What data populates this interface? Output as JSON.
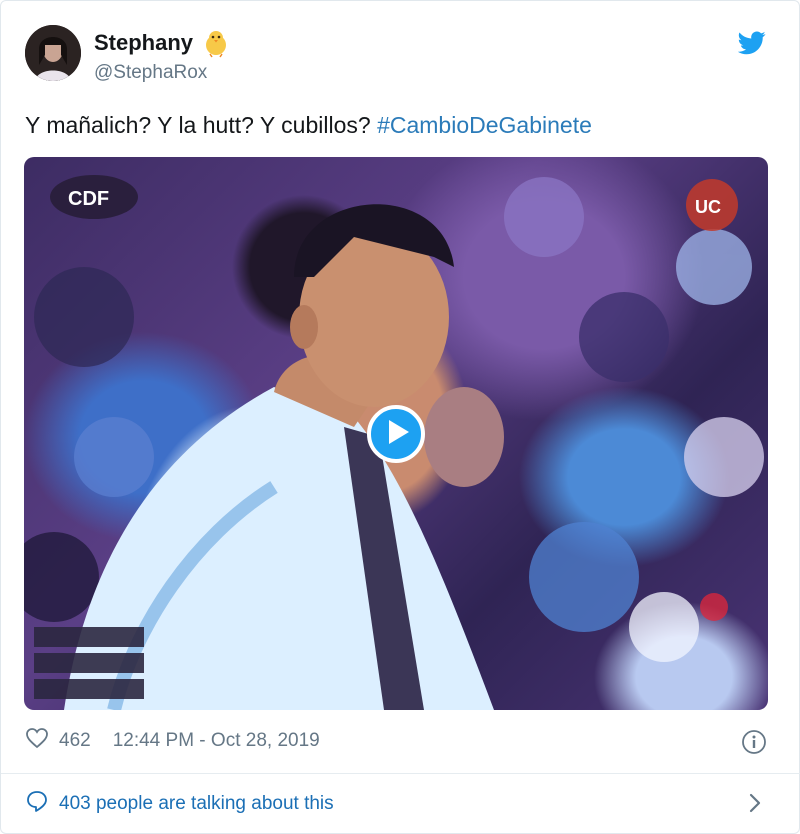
{
  "author": {
    "display_name": "Stephany",
    "handle": "@StephaRox",
    "name_emoji": "baby-chick-emoji",
    "avatar": "user-avatar"
  },
  "platform_icon": "twitter-bird-icon",
  "tweet": {
    "text": "Y mañalich? Y la hutt? Y cubillos? ",
    "hashtag": "#CambioDeGabinete"
  },
  "media": {
    "type": "video",
    "play_icon": "play-icon"
  },
  "meta": {
    "like_icon": "heart-icon",
    "likes": "462",
    "timestamp": "12:44 PM - Oct 28, 2019",
    "info_icon": "info-icon"
  },
  "footer": {
    "icon": "speech-bubble-icon",
    "text": "403 people are talking about this",
    "chevron_icon": "chevron-right-icon"
  },
  "colors": {
    "link": "#2b7bb9",
    "secondary_text": "#657786",
    "brand_blue": "#1da1f2"
  }
}
